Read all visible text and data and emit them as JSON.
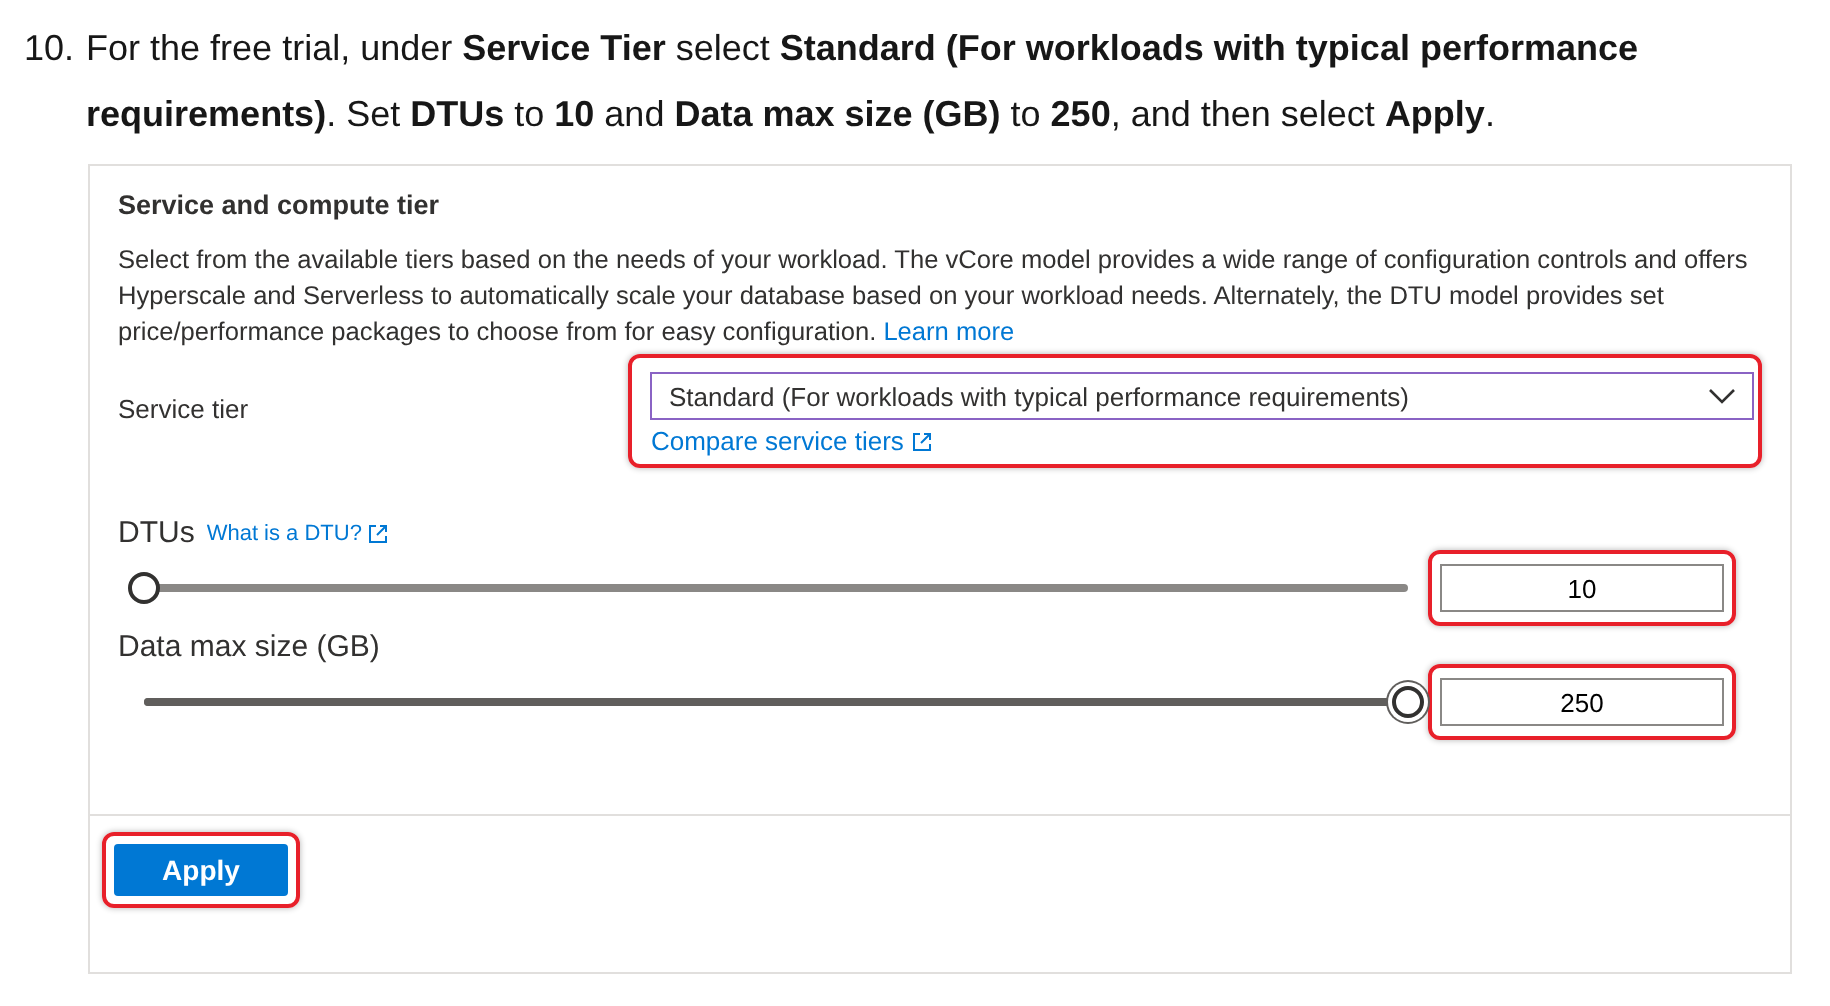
{
  "step": {
    "number": "10.",
    "text": "For the free trial, under **Service Tier** select **Standard (For workloads with typical performance requirements)**. Set **DTUs** to **10** and **Data max size (GB)** to **250**, and then select **Apply**."
  },
  "panel": {
    "title": "Service and compute tier",
    "description": "Select from the available tiers based on the needs of your workload. The vCore model provides a wide range of configuration controls and offers Hyperscale and Serverless to automatically scale your database based on your workload needs. Alternately, the DTU model provides set price/performance packages to choose from for easy configuration.",
    "learn_more": "Learn more",
    "service_tier": {
      "label": "Service tier",
      "value": "Standard (For workloads with typical performance requirements)",
      "link": "Compare service tiers",
      "highlighted": true
    },
    "sliders": [
      {
        "label": "DTUs",
        "help_link": "What is a DTU?",
        "level": 0,
        "value": "10",
        "highlighted": true
      },
      {
        "label": "Data max size (GB)",
        "level": 1,
        "value": "250",
        "highlighted": true
      }
    ],
    "apply": {
      "label": "Apply",
      "highlighted": true
    }
  }
}
